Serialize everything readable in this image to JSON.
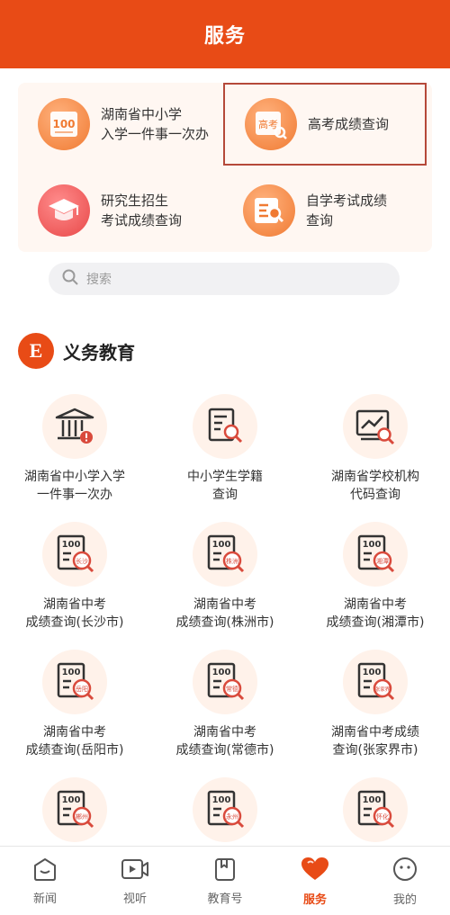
{
  "header": {
    "title": "服务"
  },
  "quick": [
    {
      "label": "湖南省中小学\n入学一件事一次办",
      "icon": "score-100-icon"
    },
    {
      "label": "高考成绩查询",
      "icon": "gaokao-search-icon",
      "icon_text": "高考"
    },
    {
      "label": "研究生招生\n考试成绩查询",
      "icon": "graduation-cap-icon"
    },
    {
      "label": "自学考试成绩\n查询",
      "icon": "document-search-icon"
    }
  ],
  "search": {
    "placeholder": "搜索"
  },
  "section": {
    "badge": "E",
    "title": "义务教育"
  },
  "grid": [
    {
      "label": "湖南省中小学入学\n一件事一次办",
      "icon": "school-building-icon"
    },
    {
      "label": "中小学生学籍\n查询",
      "icon": "document-search-icon"
    },
    {
      "label": "湖南省学校机构\n代码查询",
      "icon": "chart-search-icon"
    },
    {
      "label": "湖南省中考\n成绩查询(长沙市)",
      "icon": "score-report-icon",
      "city": "长沙"
    },
    {
      "label": "湖南省中考\n成绩查询(株洲市)",
      "icon": "score-report-icon",
      "city": "株洲"
    },
    {
      "label": "湖南省中考\n成绩查询(湘潭市)",
      "icon": "score-report-icon",
      "city": "湘潭"
    },
    {
      "label": "湖南省中考\n成绩查询(岳阳市)",
      "icon": "score-report-icon",
      "city": "岳阳"
    },
    {
      "label": "湖南省中考\n成绩查询(常德市)",
      "icon": "score-report-icon",
      "city": "常德"
    },
    {
      "label": "湖南省中考成绩\n查询(张家界市)",
      "icon": "score-report-icon",
      "city": "张家界"
    },
    {
      "label": "",
      "icon": "score-report-icon",
      "city": "郴州"
    },
    {
      "label": "",
      "icon": "score-report-icon",
      "city": "永州"
    },
    {
      "label": "",
      "icon": "score-report-icon",
      "city": "怀化"
    }
  ],
  "score_text": "100",
  "tabs": [
    {
      "label": "新闻",
      "icon": "news-icon"
    },
    {
      "label": "视听",
      "icon": "video-icon"
    },
    {
      "label": "教育号",
      "icon": "education-book-icon"
    },
    {
      "label": "服务",
      "icon": "heart-icon",
      "active": true
    },
    {
      "label": "我的",
      "icon": "profile-face-icon"
    }
  ],
  "colors": {
    "brand": "#e84b16",
    "icon_orange": "#f07a32",
    "icon_red": "#d94a3c"
  }
}
